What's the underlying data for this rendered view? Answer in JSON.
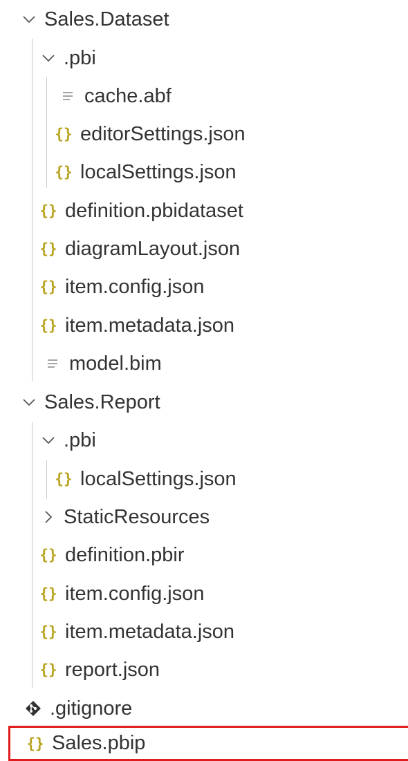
{
  "explorer": {
    "items": [
      {
        "label": "Sales.Dataset",
        "kind": "folder",
        "state": "expanded",
        "icon": "chevron-down-icon"
      },
      {
        "label": ".pbi",
        "kind": "folder",
        "state": "expanded",
        "icon": "chevron-down-icon"
      },
      {
        "label": "cache.abf",
        "kind": "file",
        "icon": "text-file-icon"
      },
      {
        "label": "editorSettings.json",
        "kind": "file",
        "icon": "json-file-icon"
      },
      {
        "label": "localSettings.json",
        "kind": "file",
        "icon": "json-file-icon"
      },
      {
        "label": "definition.pbidataset",
        "kind": "file",
        "icon": "json-file-icon"
      },
      {
        "label": "diagramLayout.json",
        "kind": "file",
        "icon": "json-file-icon"
      },
      {
        "label": "item.config.json",
        "kind": "file",
        "icon": "json-file-icon"
      },
      {
        "label": "item.metadata.json",
        "kind": "file",
        "icon": "json-file-icon"
      },
      {
        "label": "model.bim",
        "kind": "file",
        "icon": "text-file-icon"
      },
      {
        "label": "Sales.Report",
        "kind": "folder",
        "state": "expanded",
        "icon": "chevron-down-icon"
      },
      {
        "label": ".pbi",
        "kind": "folder",
        "state": "expanded",
        "icon": "chevron-down-icon"
      },
      {
        "label": "localSettings.json",
        "kind": "file",
        "icon": "json-file-icon"
      },
      {
        "label": "StaticResources",
        "kind": "folder",
        "state": "collapsed",
        "icon": "chevron-right-icon"
      },
      {
        "label": "definition.pbir",
        "kind": "file",
        "icon": "json-file-icon"
      },
      {
        "label": "item.config.json",
        "kind": "file",
        "icon": "json-file-icon"
      },
      {
        "label": "item.metadata.json",
        "kind": "file",
        "icon": "json-file-icon"
      },
      {
        "label": "report.json",
        "kind": "file",
        "icon": "json-file-icon"
      },
      {
        "label": ".gitignore",
        "kind": "file",
        "icon": "git-diamond-icon"
      },
      {
        "label": "Sales.pbip",
        "kind": "file",
        "icon": "json-file-icon",
        "selected": true
      }
    ]
  },
  "colors": {
    "json_icon": "#b8a31f",
    "text_icon": "#9a9a9a",
    "chevron": "#555555",
    "git_icon": "#333333",
    "guide": "#c8c8c8",
    "selection_border": "#e01c1c",
    "text": "#333333"
  }
}
